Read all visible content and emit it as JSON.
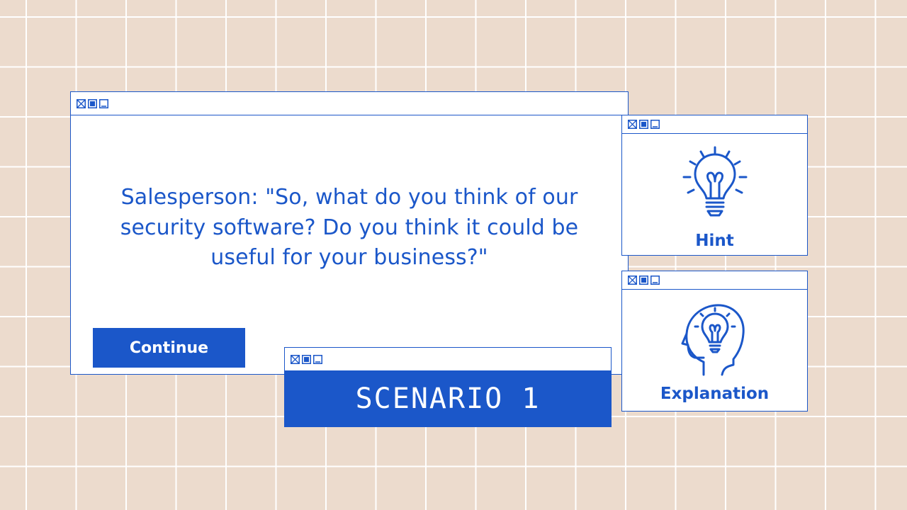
{
  "scenario": {
    "dialogue": "Salesperson: \"So, what do you think of our security software? Do you think it could be useful for your business?\"",
    "continue_label": "Continue",
    "title": "SCENARIO 1"
  },
  "panels": {
    "hint_label": "Hint",
    "explanation_label": "Explanation"
  },
  "icons": {
    "window_controls": [
      "close-icon",
      "maximize-icon",
      "minimize-icon"
    ],
    "hint": "lightbulb-icon",
    "explanation": "head-lightbulb-icon"
  },
  "colors": {
    "accent": "#1b57c9",
    "background": "#ecdbcd",
    "grid": "#ffffff",
    "panel": "#ffffff"
  }
}
